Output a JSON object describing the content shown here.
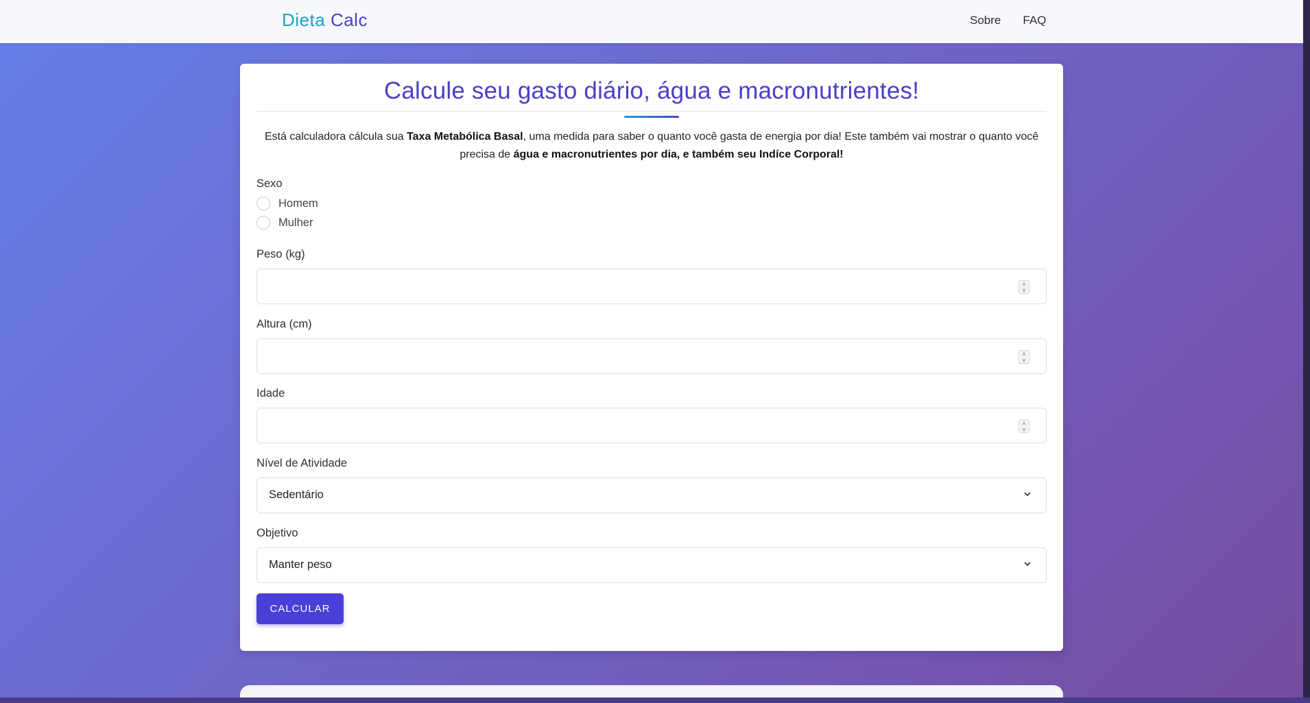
{
  "navbar": {
    "brand_part1": "Dieta",
    "brand_part2": "Calc",
    "links": [
      "Sobre",
      "FAQ"
    ]
  },
  "form": {
    "title": "Calcule seu gasto diário, água e macronutrientes!",
    "intro": {
      "p1": "Está calculadora cálcula sua ",
      "b1": "Taxa Metabólica Basal",
      "p2": ", uma medida para saber o quanto você gasta de energia por dia! Este também vai mostrar o quanto você precisa de ",
      "b2": "água e macronutrientes por dia, e também seu Indíce Corporal!"
    },
    "sexo": {
      "label": "Sexo",
      "options": [
        "Homem",
        "Mulher"
      ],
      "selected": null
    },
    "peso": {
      "label": "Peso (kg)",
      "value": ""
    },
    "altura": {
      "label": "Altura (cm)",
      "value": ""
    },
    "idade": {
      "label": "Idade",
      "value": ""
    },
    "atividade": {
      "label": "Nível de Atividade",
      "selected": "Sedentário"
    },
    "objetivo": {
      "label": "Objetivo",
      "selected": "Manter peso"
    },
    "submit_label": "CALCULAR"
  },
  "colors": {
    "accent": "#4a3fc8",
    "brand_cyan": "#17a2c7",
    "button": "#4a3fd6",
    "gradient_start": "#667eea",
    "gradient_end": "#764ba2"
  }
}
